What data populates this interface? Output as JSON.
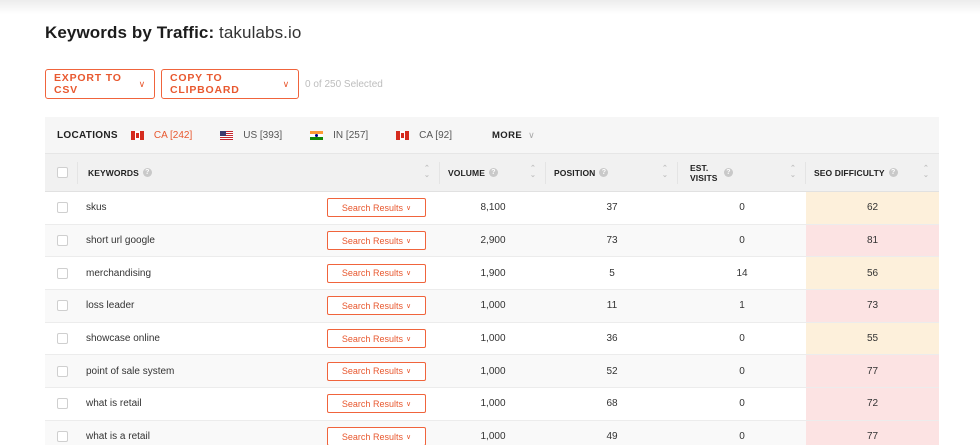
{
  "page": {
    "title_prefix": "Keywords by Traffic:",
    "domain": "takulabs.io"
  },
  "toolbar": {
    "export_label": "EXPORT TO CSV",
    "copy_label": "COPY TO CLIPBOARD",
    "selected_text": "0 of 250 Selected"
  },
  "locations": {
    "label": "LOCATIONS",
    "items": [
      {
        "flag": "ca",
        "text": "CA [242]",
        "active": true
      },
      {
        "flag": "us",
        "text": "US [393]",
        "active": false
      },
      {
        "flag": "in",
        "text": "IN [257]",
        "active": false
      },
      {
        "flag": "ca",
        "text": "CA [92]",
        "active": false
      }
    ],
    "more_label": "MORE"
  },
  "table": {
    "headers": {
      "keywords": "KEYWORDS",
      "volume": "VOLUME",
      "position": "POSITION",
      "est_visits": "EST. VISITS",
      "seo_difficulty": "SEO DIFFICULTY"
    },
    "search_results_label": "Search Results",
    "rows": [
      {
        "keyword": "skus",
        "volume": "8,100",
        "position": "37",
        "visits": "0",
        "difficulty": "62",
        "level": "mid"
      },
      {
        "keyword": "short url google",
        "volume": "2,900",
        "position": "73",
        "visits": "0",
        "difficulty": "81",
        "level": "high"
      },
      {
        "keyword": "merchandising",
        "volume": "1,900",
        "position": "5",
        "visits": "14",
        "difficulty": "56",
        "level": "mid"
      },
      {
        "keyword": "loss leader",
        "volume": "1,000",
        "position": "11",
        "visits": "1",
        "difficulty": "73",
        "level": "high"
      },
      {
        "keyword": "showcase online",
        "volume": "1,000",
        "position": "36",
        "visits": "0",
        "difficulty": "55",
        "level": "mid"
      },
      {
        "keyword": "point of sale system",
        "volume": "1,000",
        "position": "52",
        "visits": "0",
        "difficulty": "77",
        "level": "high"
      },
      {
        "keyword": "what is retail",
        "volume": "1,000",
        "position": "68",
        "visits": "0",
        "difficulty": "72",
        "level": "high"
      },
      {
        "keyword": "what is a retail",
        "volume": "1,000",
        "position": "49",
        "visits": "0",
        "difficulty": "77",
        "level": "high"
      }
    ]
  },
  "colors": {
    "accent": "#e8582f",
    "difficulty_mid": "#fdf0db",
    "difficulty_high": "#fce3e3"
  }
}
